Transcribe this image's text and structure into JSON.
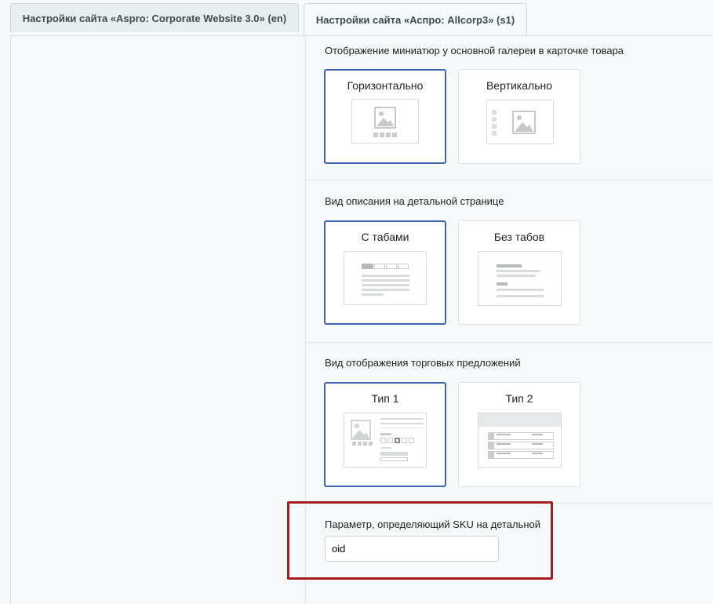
{
  "tabs": [
    {
      "label": "Настройки сайта «Aspro: Corporate Website 3.0» (en)"
    },
    {
      "label": "Настройки сайта «Аспро: Allcorp3» (s1)"
    }
  ],
  "sections": [
    {
      "title": "Отображение миниатюр у основной галереи в карточке товара",
      "options": [
        {
          "label": "Горизонтально",
          "selected": true,
          "icon": "gallery-horizontal-icon"
        },
        {
          "label": "Вертикально",
          "selected": false,
          "icon": "gallery-vertical-icon"
        }
      ]
    },
    {
      "title": "Вид описания на детальной странице",
      "options": [
        {
          "label": "С табами",
          "selected": true,
          "icon": "tabs-layout-icon"
        },
        {
          "label": "Без табов",
          "selected": false,
          "icon": "no-tabs-layout-icon"
        }
      ]
    },
    {
      "title": "Вид отображения торговых предложений",
      "options": [
        {
          "label": "Тип 1",
          "selected": true,
          "icon": "offers-type1-icon"
        },
        {
          "label": "Тип 2",
          "selected": false,
          "icon": "offers-type2-icon"
        }
      ]
    }
  ],
  "sku_field": {
    "label": "Параметр, определяющий SKU на детальной",
    "value": "oid"
  },
  "colors": {
    "selected_border": "#3f64b5",
    "highlight_border": "#a61b1b",
    "background": "#f5f9f9"
  }
}
